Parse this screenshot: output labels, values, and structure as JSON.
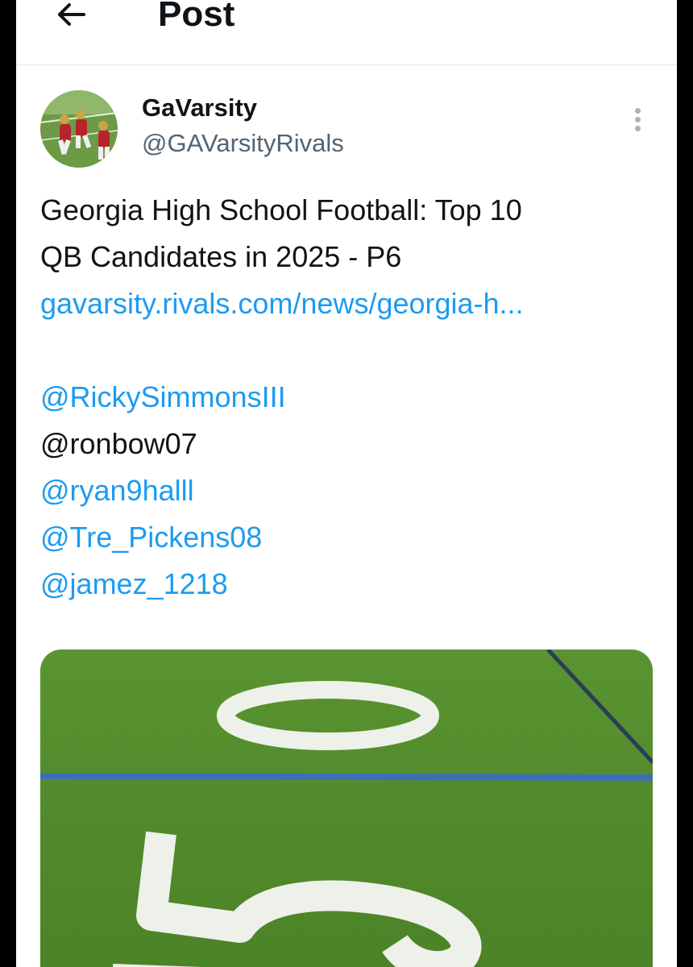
{
  "header": {
    "title": "Post",
    "back_icon": "arrow-left-icon"
  },
  "post": {
    "author": {
      "display_name": "GaVarsity",
      "handle": "@GAVarsityRivals"
    },
    "more_icon": "more-vertical-icon",
    "text_line_1": "Georgia High School Football: Top 10",
    "text_line_2": "QB Candidates in 2025 - P6",
    "link_text": "gavarsity.rivals.com/news/georgia-h...",
    "mentions": [
      {
        "text": "@RickySimmonsIII",
        "linked": true
      },
      {
        "text": "@ronbow07",
        "linked": false
      },
      {
        "text": "@ryan9halll",
        "linked": true
      },
      {
        "text": "@Tre_Pickens08",
        "linked": true
      },
      {
        "text": "@jamez_1218",
        "linked": true
      }
    ]
  },
  "colors": {
    "accent": "#1d9bf0",
    "text": "#0f1419",
    "secondary_text": "#536471",
    "turf": "#4f8a2a"
  }
}
